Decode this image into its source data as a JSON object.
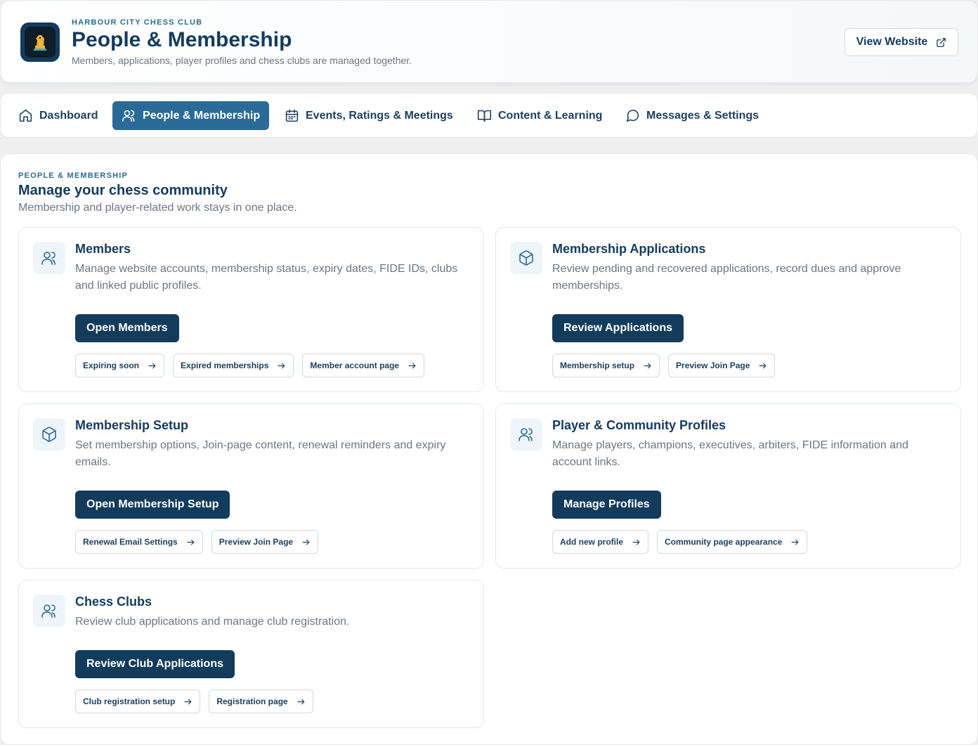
{
  "header": {
    "kicker": "HARBOUR CITY CHESS CLUB",
    "title": "People & Membership",
    "subtitle": "Members, applications, player profiles and chess clubs are managed together.",
    "view_website": "View Website",
    "logo_icon": "chess-knight-icon"
  },
  "nav": [
    {
      "label": "Dashboard",
      "icon": "home-icon"
    },
    {
      "label": "People & Membership",
      "icon": "users-icon",
      "active": true
    },
    {
      "label": "Events, Ratings & Meetings",
      "icon": "calendar-icon"
    },
    {
      "label": "Content & Learning",
      "icon": "book-icon"
    },
    {
      "label": "Messages & Settings",
      "icon": "chat-icon"
    }
  ],
  "section": {
    "kicker": "PEOPLE & MEMBERSHIP",
    "title": "Manage your chess community",
    "subtitle": "Membership and player-related work stays in one place."
  },
  "cards": [
    {
      "title": "Members",
      "icon": "users-icon",
      "description": "Manage website accounts, membership status, expiry dates, FIDE IDs, clubs and linked public profiles.",
      "button": "Open Members",
      "links": [
        "Expiring soon",
        "Expired memberships",
        "Member account page"
      ]
    },
    {
      "title": "Membership Applications",
      "icon": "box-icon",
      "description": "Review pending and recovered applications, record dues and approve memberships.",
      "button": "Review Applications",
      "links": [
        "Membership setup",
        "Preview Join Page"
      ]
    },
    {
      "title": "Membership Setup",
      "icon": "box-icon",
      "description": "Set membership options, Join-page content, renewal reminders and expiry emails.",
      "button": "Open Membership Setup",
      "links": [
        "Renewal Email Settings",
        "Preview Join Page"
      ]
    },
    {
      "title": "Player & Community Profiles",
      "icon": "users-icon",
      "description": "Manage players, champions, executives, arbiters, FIDE information and account links.",
      "button": "Manage Profiles",
      "links": [
        "Add new profile",
        "Community page appearance"
      ]
    },
    {
      "title": "Chess Clubs",
      "icon": "users-icon",
      "description": "Review club applications and manage club registration.",
      "button": "Review Club Applications",
      "links": [
        "Club registration setup",
        "Registration page"
      ]
    }
  ]
}
